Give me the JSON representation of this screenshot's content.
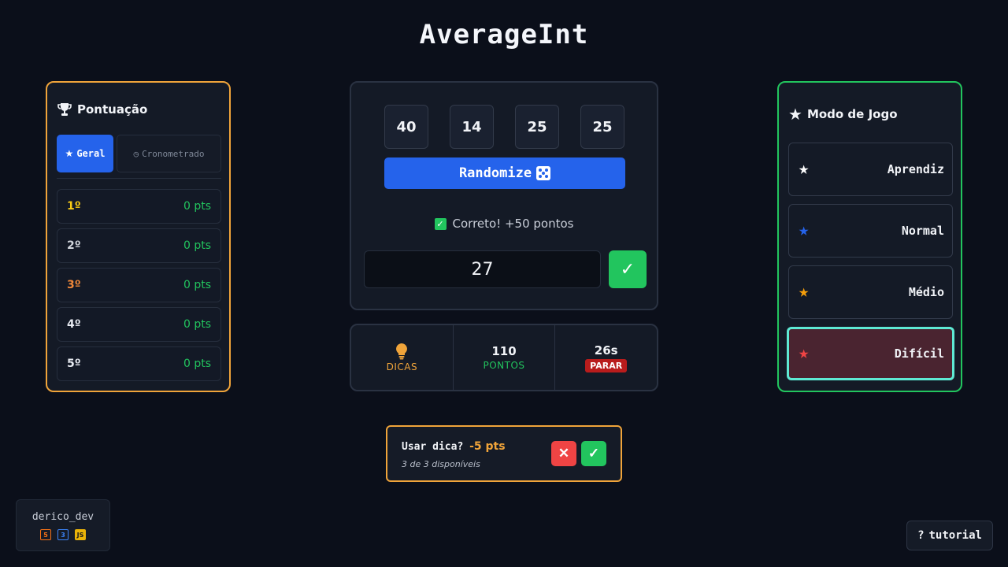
{
  "app": {
    "title": "AverageInt"
  },
  "score": {
    "heading": "Pontuação",
    "tabs": [
      {
        "label": "Geral",
        "active": true
      },
      {
        "label": "Cronometrado",
        "active": false
      }
    ],
    "ranks": [
      {
        "pos": "1º",
        "pts": "0 pts",
        "color": "#facc15"
      },
      {
        "pos": "2º",
        "pts": "0 pts",
        "color": "#d1d5db"
      },
      {
        "pos": "3º",
        "pts": "0 pts",
        "color": "#f0883a"
      },
      {
        "pos": "4º",
        "pts": "0 pts",
        "color": "#f1f3f7"
      },
      {
        "pos": "5º",
        "pts": "0 pts",
        "color": "#f1f3f7"
      }
    ]
  },
  "game": {
    "numbers": [
      "40",
      "14",
      "25",
      "25"
    ],
    "randomize_label": "Randomize",
    "feedback": "Correto! +50 pontos",
    "answer_value": "27"
  },
  "stats": {
    "hints_label": "DICAS",
    "points_value": "110",
    "points_label": "PONTOS",
    "time_value": "26s",
    "stop_label": "PARAR"
  },
  "mode": {
    "heading": "Modo de Jogo",
    "items": [
      {
        "label": "Aprendiz",
        "star_color": "#ffffff",
        "selected": false
      },
      {
        "label": "Normal",
        "star_color": "#2563eb",
        "selected": false
      },
      {
        "label": "Médio",
        "star_color": "#f59e0b",
        "selected": false
      },
      {
        "label": "Difícil",
        "star_color": "#ef4444",
        "selected": true
      }
    ]
  },
  "hint_popup": {
    "question": "Usar dica?",
    "cost": "-5 pts",
    "availability": "3 de 3 disponíveis"
  },
  "footer": {
    "dev_name": "derico_dev",
    "tech": [
      "html5-icon",
      "css3-icon",
      "js-icon"
    ],
    "tutorial_label": "tutorial"
  },
  "colors": {
    "accent_blue": "#2563eb",
    "success_green": "#22c55e",
    "warning_orange": "#f0a43a",
    "danger_red": "#ef4444",
    "selected_border": "#5eead4"
  }
}
